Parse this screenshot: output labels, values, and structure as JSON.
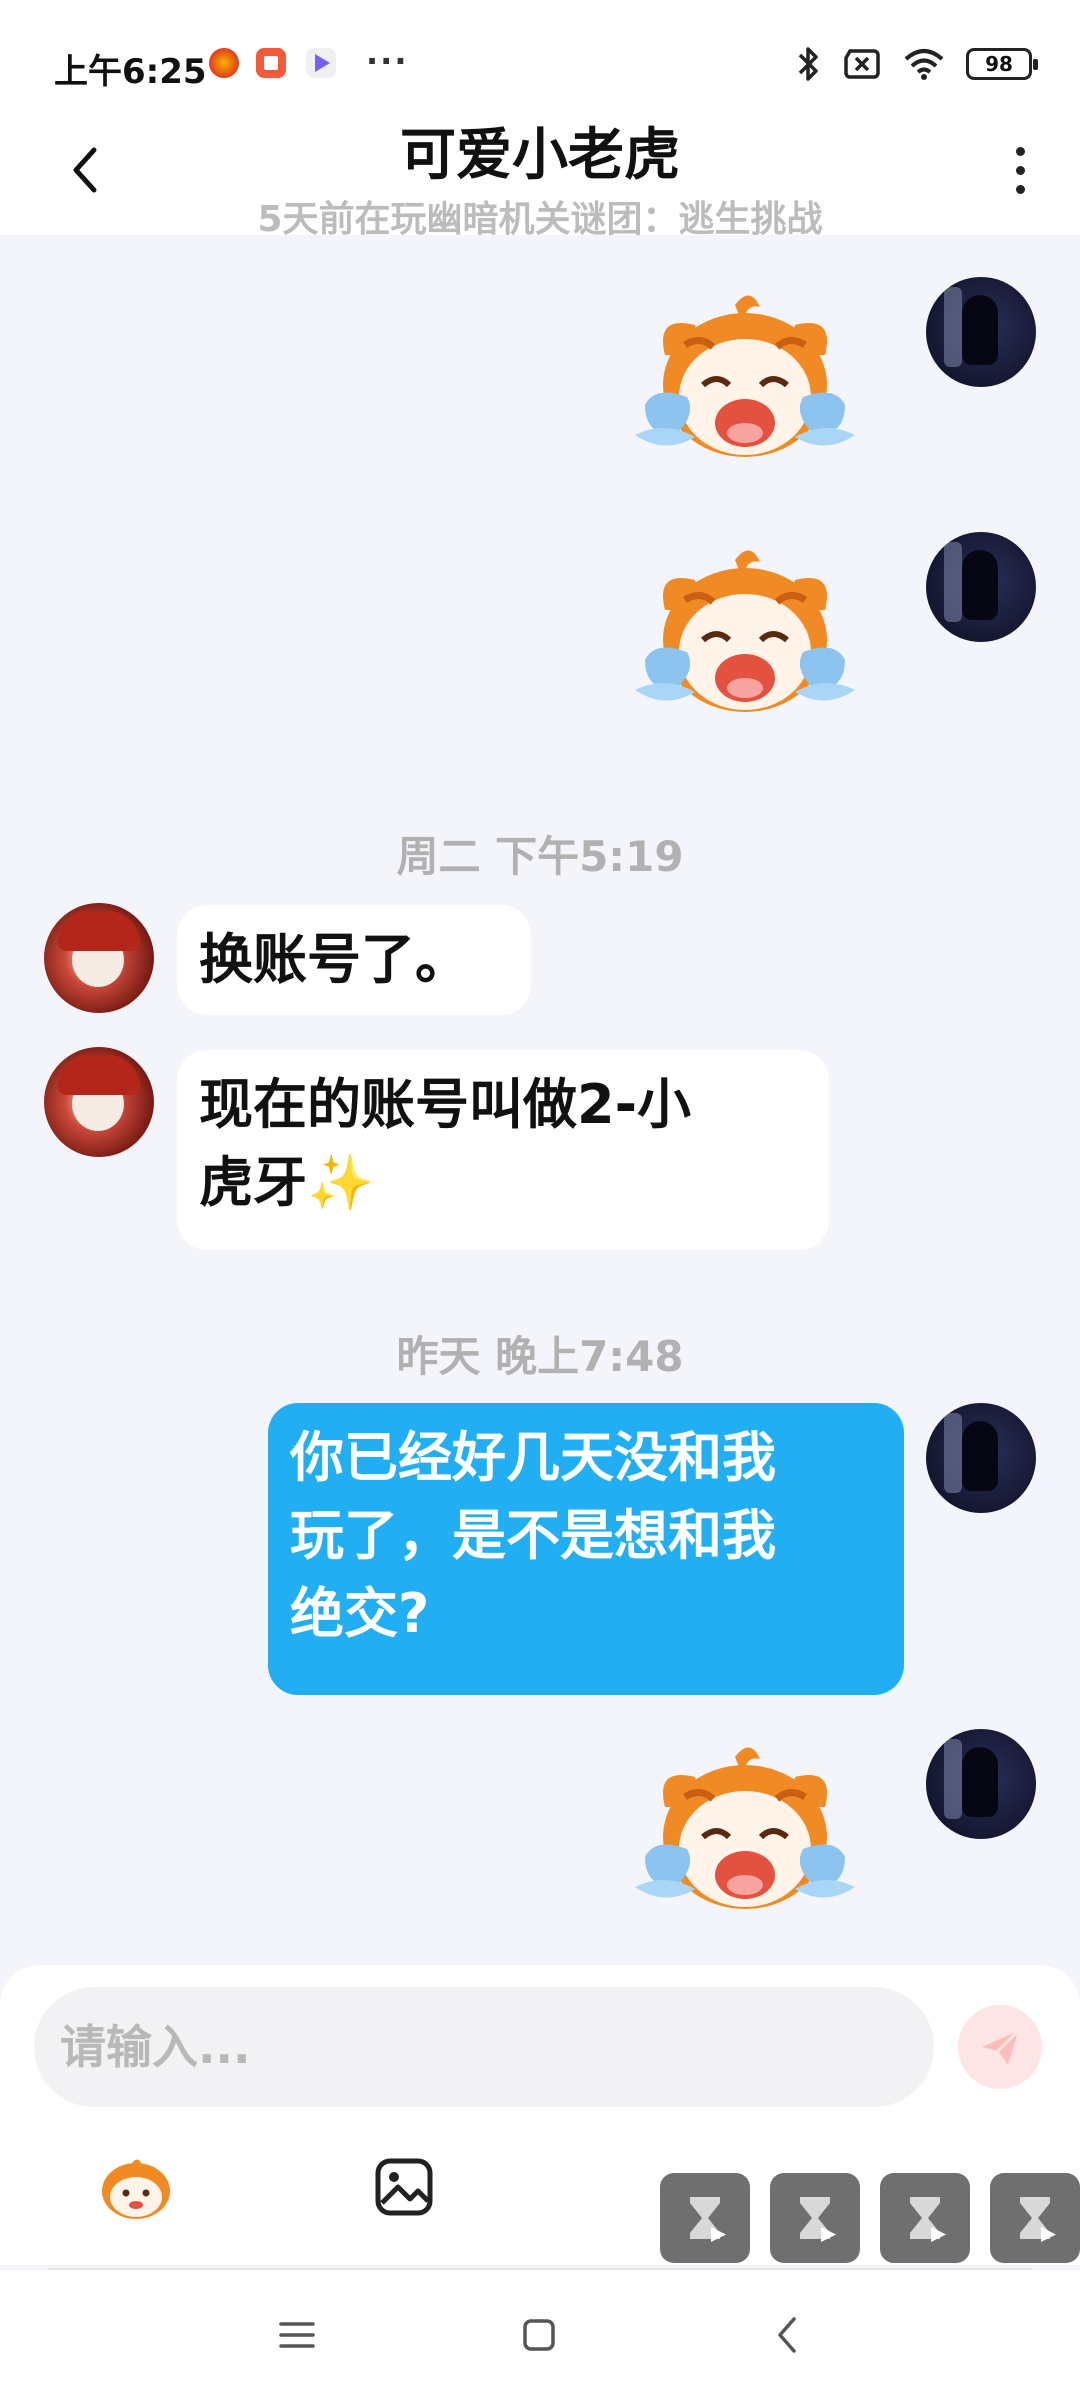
{
  "status_bar": {
    "time": "上午6:25",
    "more": "···",
    "battery": "98",
    "icons": [
      "weibo-app-icon",
      "orange-app-icon",
      "video-app-icon",
      "bluetooth-icon",
      "no-sim-icon",
      "wifi-icon",
      "battery-icon"
    ]
  },
  "header": {
    "title": "可爱小老虎",
    "subtitle": "5天前在玩幽暗机关谜团：逃生挑战"
  },
  "messages": [
    {
      "side": "out",
      "type": "sticker",
      "sticker": "crying-tiger-sticker"
    },
    {
      "side": "out",
      "type": "sticker",
      "sticker": "crying-tiger-sticker"
    },
    {
      "type": "timestamp",
      "text": "周二 下午5:19"
    },
    {
      "side": "in",
      "type": "text",
      "text": "换账号了。"
    },
    {
      "side": "in",
      "type": "text",
      "line1": "现在的账号叫做2-小",
      "line2": "虎牙✨"
    },
    {
      "type": "timestamp",
      "text": "昨天 晚上7:48"
    },
    {
      "side": "out",
      "type": "text",
      "line1": "你已经好几天没和我",
      "line2": "玩了，是不是想和我",
      "line3": "绝交?"
    },
    {
      "side": "out",
      "type": "sticker",
      "sticker": "crying-tiger-sticker"
    }
  ],
  "input": {
    "placeholder": "请输入...",
    "value": ""
  },
  "toolbar": {
    "icons": [
      "tiger-emoji-icon",
      "image-icon",
      "game-icon",
      "game-icon",
      "game-icon",
      "game-icon"
    ]
  },
  "colors": {
    "background": "#f4f5fa",
    "outgoing_bubble": "#21aef2",
    "incoming_bubble": "#ffffff",
    "timestamp": "#b1b1b1",
    "send_button": "#fde5e5"
  }
}
